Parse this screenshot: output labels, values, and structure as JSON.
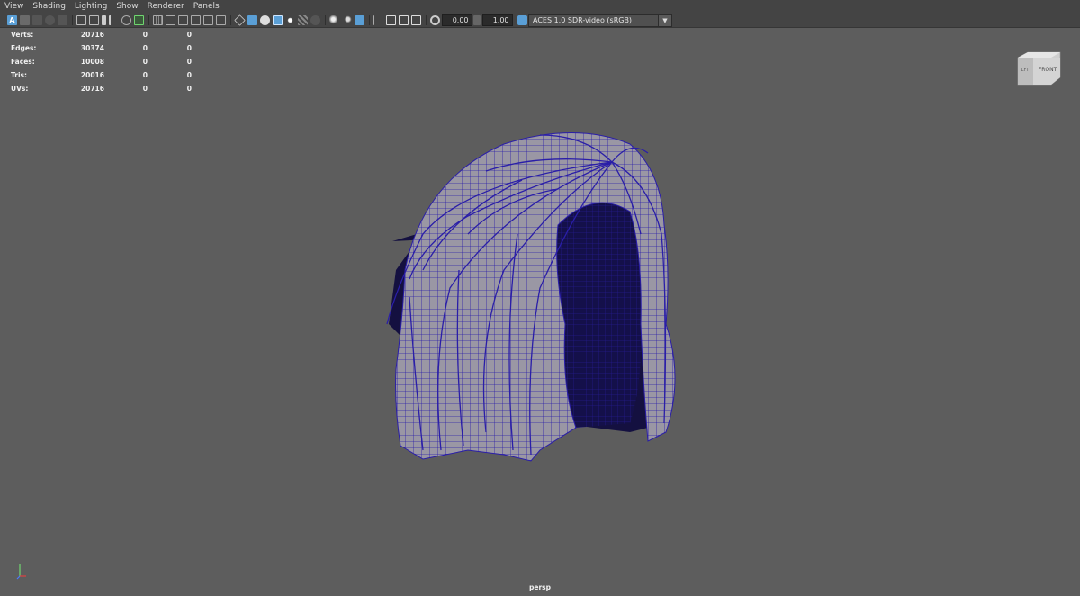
{
  "menubar": {
    "items": [
      "View",
      "Shading",
      "Lighting",
      "Show",
      "Renderer",
      "Panels"
    ]
  },
  "toolbar": {
    "near_clip_value": "0.00",
    "gamma_value": "1.00",
    "color_space": "ACES 1.0 SDR-video (sRGB)",
    "select_badge": "A",
    "colors": {
      "active": "#5a9fd6",
      "bg": "#444444"
    }
  },
  "hud": {
    "rows": [
      {
        "label": "Verts:",
        "v1": "20716",
        "v2": "0",
        "v3": "0"
      },
      {
        "label": "Edges:",
        "v1": "30374",
        "v2": "0",
        "v3": "0"
      },
      {
        "label": "Faces:",
        "v1": "10008",
        "v2": "0",
        "v3": "0"
      },
      {
        "label": "Tris:",
        "v1": "20016",
        "v2": "0",
        "v3": "0"
      },
      {
        "label": "UVs:",
        "v1": "20716",
        "v2": "0",
        "v3": "0"
      }
    ]
  },
  "viewcube": {
    "front_label": "FRONT",
    "side_label": "LFT"
  },
  "viewport": {
    "camera_name": "persp",
    "background": "#5d5d5d",
    "wire_color": "#2a1ea8"
  }
}
